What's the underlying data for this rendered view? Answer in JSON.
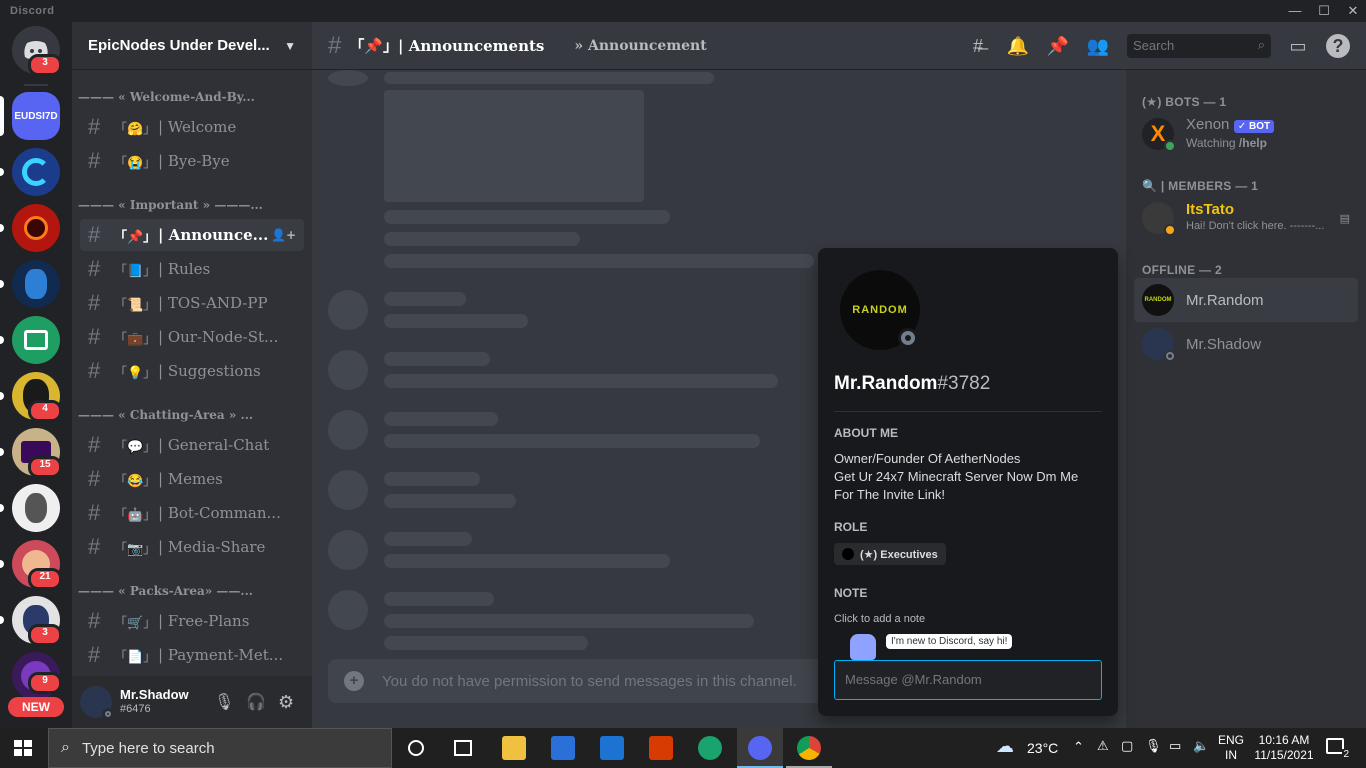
{
  "window": {
    "app_title": "Discord",
    "minimize": "—",
    "maximize": "☐",
    "close": "✕"
  },
  "guilds": [
    {
      "name": "home",
      "badge": "3",
      "color": "#36393f"
    },
    {
      "name": "EUDSI7D",
      "label": "EUDSI7D",
      "color": "#5865f2"
    },
    {
      "name": "server-c",
      "color": "#1b3c8a"
    },
    {
      "name": "server-red",
      "color": "#b3160f"
    },
    {
      "name": "server-blue",
      "color": "#102a50"
    },
    {
      "name": "server-green",
      "color": "#1f9e63"
    },
    {
      "name": "server-4",
      "badge": "4",
      "color": "#d8b630"
    },
    {
      "name": "server-15",
      "badge": "15",
      "color": "#c7b28a"
    },
    {
      "name": "server-white",
      "color": "#efefef"
    },
    {
      "name": "server-21",
      "badge": "21",
      "color": "#cc4a5a"
    },
    {
      "name": "server-3",
      "badge": "3",
      "color": "#e3e3e3"
    },
    {
      "name": "server-9",
      "badge": "9",
      "color": "#3a1a5a"
    }
  ],
  "new_badge": "NEW",
  "server": {
    "name": "EpicNodes Under Devel..."
  },
  "categories": [
    "——— « Welcome-And-By...",
    "——— « Important » ———...",
    "——— « Chatting-Area » ...",
    "——— « Packs-Area» ——..."
  ],
  "channels": [
    {
      "emoji": "「🤗」",
      "name": "| Welcome"
    },
    {
      "emoji": "「😭」",
      "name": "| Bye-Bye"
    },
    {
      "emoji": "「📌」",
      "name": "| Announce..."
    },
    {
      "emoji": "「📘」",
      "name": "| Rules"
    },
    {
      "emoji": "「📜」",
      "name": "| TOS-AND-PP"
    },
    {
      "emoji": "「💼」",
      "name": "| Our-Node-St..."
    },
    {
      "emoji": "「💡」",
      "name": "| Suggestions"
    },
    {
      "emoji": "「💬」",
      "name": "| General-Chat"
    },
    {
      "emoji": "「😂」",
      "name": "| Memes"
    },
    {
      "emoji": "「🤖」",
      "name": "| Bot-Comman..."
    },
    {
      "emoji": "「📷」",
      "name": "| Media-Share"
    },
    {
      "emoji": "「🛒」",
      "name": "| Free-Plans"
    },
    {
      "emoji": "「📄」",
      "name": "| Payment-Met..."
    }
  ],
  "user": {
    "name": "Mr.Shadow",
    "tag": "#6476"
  },
  "header": {
    "channel": "「📌」| Announcements",
    "topic": "» Announcement",
    "search_placeholder": "Search"
  },
  "composer": {
    "placeholder": "You do not have permission to send messages in this channel."
  },
  "members": {
    "bots_header": "(★) BOTS — 1",
    "bot": {
      "name": "Xenon",
      "badge": "✓ BOT",
      "status_prefix": "Watching ",
      "status_bold": "/help"
    },
    "members_header": "🔍 | MEMBERS — 1",
    "member": {
      "name": "ItsTato",
      "status": "Hai! Don't click here. -------...",
      "color": "#f1c40f"
    },
    "offline_header": "OFFLINE — 2",
    "offline": [
      {
        "name": "Mr.Random"
      },
      {
        "name": "Mr.Shadow"
      }
    ]
  },
  "popout": {
    "avatar_text": "RANDOM",
    "username": "Mr.Random",
    "discriminator": "#3782",
    "about_label": "ABOUT ME",
    "about_lines": [
      "Owner/Founder Of AetherNodes",
      "Get Ur 24x7 Minecraft Server Now Dm Me",
      "For The Invite Link!"
    ],
    "role_label": "ROLE",
    "role": "(★) Executives",
    "note_label": "NOTE",
    "note_placeholder": "Click to add a note",
    "wumpus_text": "I'm new to Discord, say hi!",
    "message_placeholder": "Message @Mr.Random"
  },
  "taskbar": {
    "search_placeholder": "Type here to search",
    "weather": "23°C",
    "lang1": "ENG",
    "lang2": "IN",
    "time": "10:16 AM",
    "date": "11/15/2021",
    "notifications": "2"
  }
}
